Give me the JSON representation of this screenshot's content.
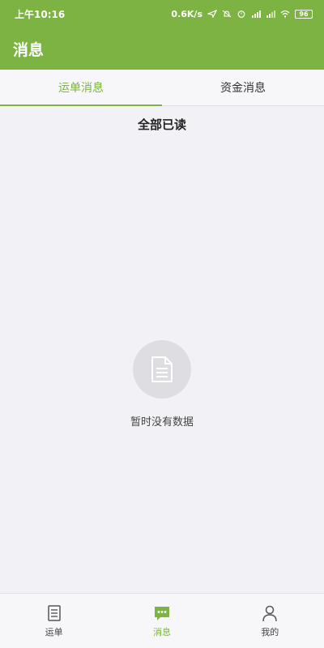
{
  "statusbar": {
    "time": "上午10:16",
    "speed": "0.6K/s",
    "battery": "96",
    "icons": [
      "location-icon",
      "mute-icon",
      "alarm-icon",
      "hd-signal-icon",
      "signal-icon",
      "wifi-icon",
      "battery-icon"
    ]
  },
  "appbar": {
    "title": "消息"
  },
  "tabs": [
    {
      "label": "运单消息",
      "active": true
    },
    {
      "label": "资金消息",
      "active": false
    }
  ],
  "mark_all_read": "全部已读",
  "empty": {
    "icon": "document-icon",
    "text": "暂时没有数据"
  },
  "bottom_nav": [
    {
      "label": "运单",
      "icon": "waybill-icon",
      "active": false
    },
    {
      "label": "消息",
      "icon": "message-icon",
      "active": true
    },
    {
      "label": "我的",
      "icon": "user-icon",
      "active": false
    }
  ],
  "colors": {
    "accent": "#7cb342",
    "background": "#f2f2f6"
  }
}
